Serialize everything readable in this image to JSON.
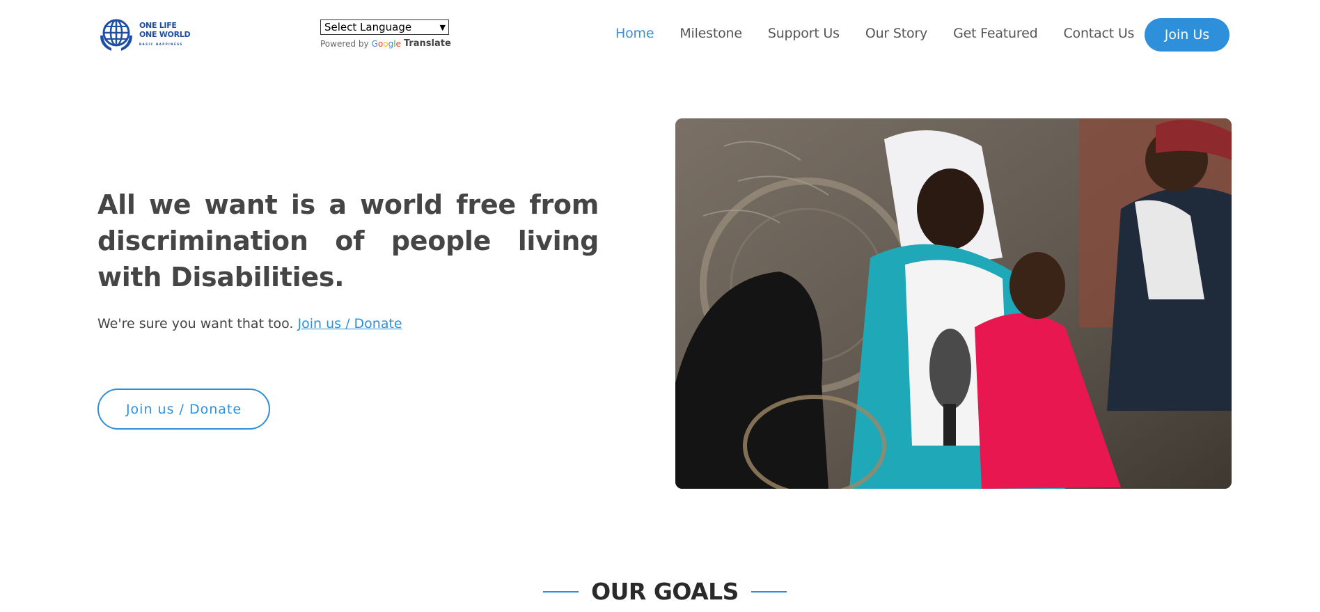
{
  "header": {
    "logo": {
      "line1": "ONE LIFE",
      "line2": "ONE WORLD",
      "tagline": "BASIC HAPPINESS",
      "icon": "globe-hands-icon"
    },
    "translate": {
      "select_value": "Select Language",
      "powered_by": "Powered by",
      "google": "Google",
      "translate_label": "Translate"
    },
    "nav": [
      {
        "label": "Home",
        "active": true
      },
      {
        "label": "Milestone"
      },
      {
        "label": "Support Us"
      },
      {
        "label": "Our Story"
      },
      {
        "label": "Get Featured"
      },
      {
        "label": "Contact Us"
      }
    ],
    "join_label": "Join Us"
  },
  "hero": {
    "title": "All we want is a world free from discrimination of people living with Disabilities.",
    "subtitle": "We're sure you want that too.",
    "subtitle_link": "Join us / Donate",
    "button_label": "Join us / Donate",
    "image": "photo-women-child-wheelchair-interview"
  },
  "goals": {
    "heading": "OUR GOALS"
  },
  "colors": {
    "accent": "#2e8fdb",
    "text": "#454545",
    "logo": "#1e4fa3"
  }
}
